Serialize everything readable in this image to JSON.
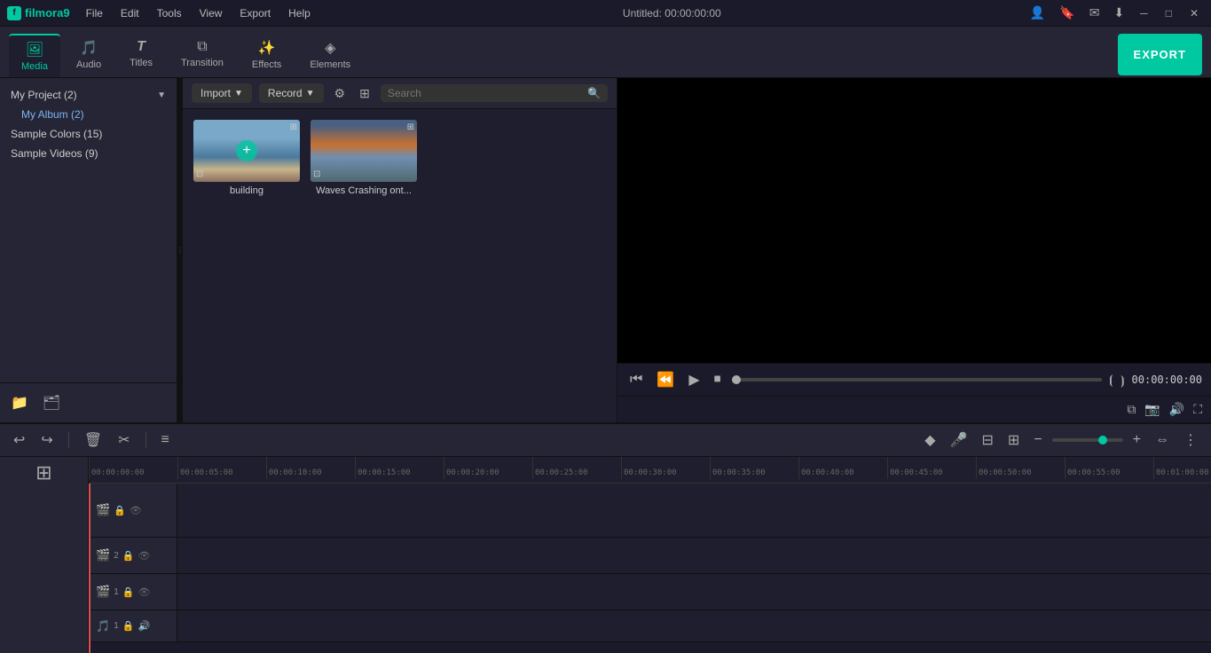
{
  "titlebar": {
    "app_name": "filmora9",
    "title": "Untitled:",
    "timecode": "00:00:00:00",
    "menu_items": [
      "File",
      "Edit",
      "Tools",
      "View",
      "Export",
      "Help"
    ]
  },
  "toolbar": {
    "tabs": [
      {
        "id": "media",
        "label": "Media",
        "icon": "🖼",
        "active": true
      },
      {
        "id": "audio",
        "label": "Audio",
        "icon": "🎵",
        "active": false
      },
      {
        "id": "titles",
        "label": "Titles",
        "icon": "T",
        "active": false
      },
      {
        "id": "transition",
        "label": "Transition",
        "icon": "⧉",
        "active": false
      },
      {
        "id": "effects",
        "label": "Effects",
        "icon": "✨",
        "active": false
      },
      {
        "id": "elements",
        "label": "Elements",
        "icon": "◈",
        "active": false
      }
    ],
    "export_label": "EXPORT"
  },
  "project_tree": {
    "header_label": "My Project (2)",
    "items": [
      {
        "label": "My Album (2)",
        "indent": true
      },
      {
        "label": "Sample Colors (15)",
        "indent": false
      },
      {
        "label": "Sample Videos (9)",
        "indent": false
      }
    ]
  },
  "media_browser": {
    "import_label": "Import",
    "record_label": "Record",
    "search_placeholder": "Search",
    "items": [
      {
        "id": "building",
        "label": "building",
        "type": "building"
      },
      {
        "id": "waves",
        "label": "Waves Crashing ont...",
        "type": "waves"
      }
    ]
  },
  "preview": {
    "timecode": "00:00:00:00"
  },
  "timeline": {
    "toolbar_buttons": [
      "undo",
      "redo",
      "delete",
      "cut",
      "settings"
    ],
    "ruler_marks": [
      "00:00:00:00",
      "00:00:05:00",
      "00:00:10:00",
      "00:00:15:00",
      "00:00:20:00",
      "00:00:25:00",
      "00:00:30:00",
      "00:00:35:00",
      "00:00:40:00",
      "00:00:45:00",
      "00:00:50:00",
      "00:00:55:00",
      "00:01:00:00"
    ],
    "tracks": [
      {
        "id": "track-main",
        "num": "",
        "icon": "🎬",
        "lock": true,
        "eye": true,
        "type": "main"
      },
      {
        "id": "track-2",
        "num": "2",
        "icon": "🎬",
        "lock": true,
        "eye": true,
        "type": "video"
      },
      {
        "id": "track-1",
        "num": "1",
        "icon": "🎬",
        "lock": true,
        "eye": true,
        "type": "video"
      },
      {
        "id": "audio-1",
        "num": "1",
        "icon": "🎵",
        "lock": true,
        "sound": true,
        "type": "audio"
      }
    ]
  }
}
